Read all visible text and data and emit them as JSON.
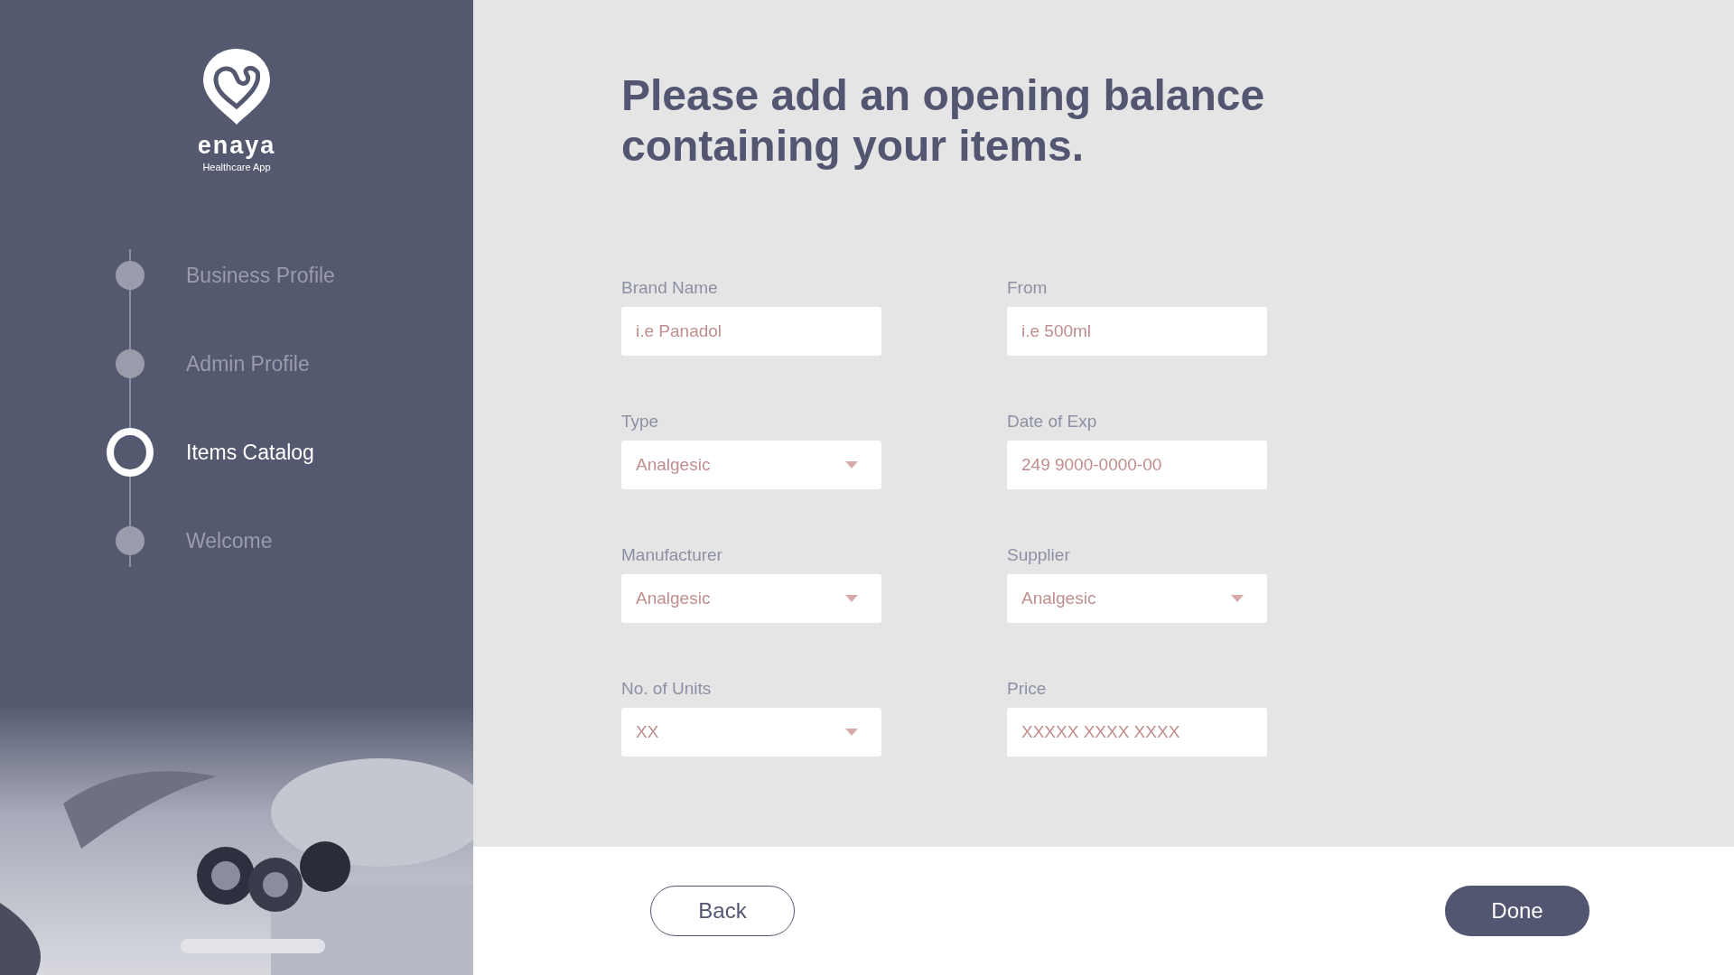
{
  "brand": {
    "name": "enaya",
    "tagline": "Healthcare App"
  },
  "steps": [
    {
      "label": "Business Profile",
      "selected": false
    },
    {
      "label": "Admin Profile",
      "selected": false
    },
    {
      "label": "Items Catalog",
      "selected": true
    },
    {
      "label": "Welcome",
      "selected": false
    }
  ],
  "heading": "Please add an opening balance containing your items.",
  "fields": [
    {
      "label": "Brand Name",
      "kind": "text",
      "placeholder": "i.e Panadol"
    },
    {
      "label": "From",
      "kind": "text",
      "placeholder": "i.e 500ml"
    },
    {
      "label": "Type",
      "kind": "select",
      "placeholder": "Analgesic"
    },
    {
      "label": "Date of Exp",
      "kind": "text",
      "placeholder": "249 9000-0000-00"
    },
    {
      "label": "Manufacturer",
      "kind": "select",
      "placeholder": "Analgesic"
    },
    {
      "label": "Supplier",
      "kind": "select",
      "placeholder": "Analgesic"
    },
    {
      "label": "No. of Units",
      "kind": "select",
      "placeholder": "XX"
    },
    {
      "label": "Price",
      "kind": "text",
      "placeholder": "XXXXX XXXX XXXX"
    }
  ],
  "buttons": {
    "back": "Back",
    "done": "Done"
  }
}
